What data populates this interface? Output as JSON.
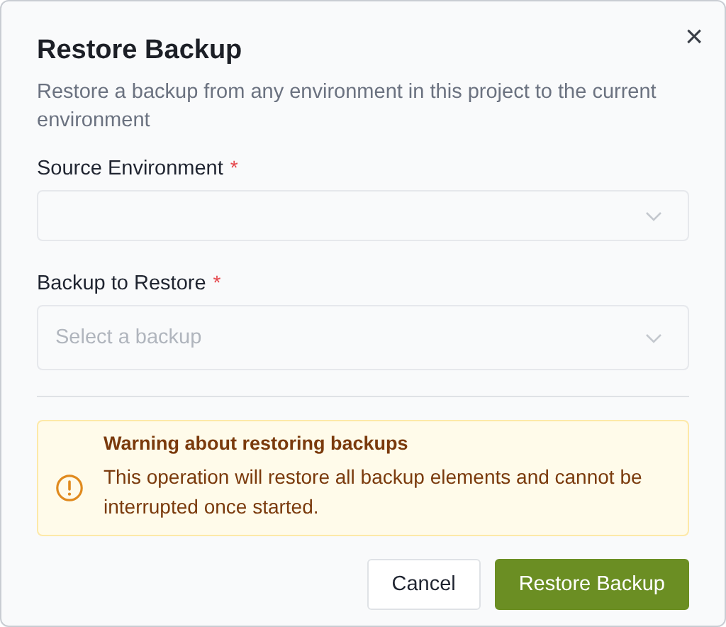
{
  "dialog": {
    "title": "Restore Backup",
    "close_icon": "×",
    "description": "Restore a backup from any environment in this project to the current environment"
  },
  "fields": [
    {
      "label": "Source Environment",
      "required_mark": "*"
    },
    {
      "label": "Backup to Restore",
      "required_mark": "*",
      "placeholder": "Select a backup"
    }
  ],
  "alert": {
    "kind": "warning",
    "title": "Warning about restoring backups",
    "message": "This operation will restore all backup elements and cannot be interrupted once started."
  },
  "buttons": [
    {
      "label": "Cancel",
      "kind": "secondary"
    },
    {
      "label": "Restore Backup",
      "kind": "primary"
    }
  ]
}
